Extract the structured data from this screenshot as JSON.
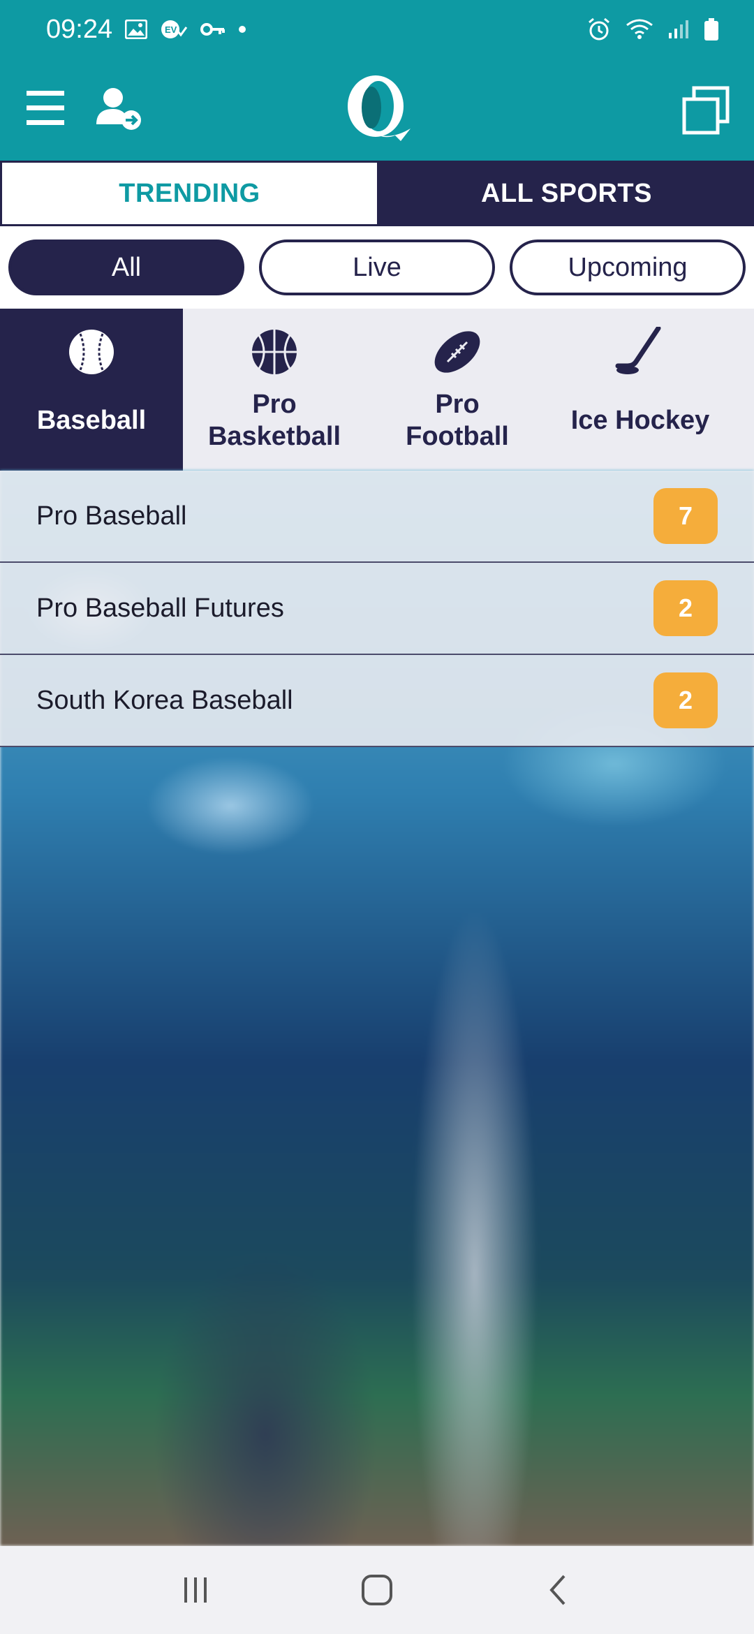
{
  "status_bar": {
    "time": "09:24",
    "left_icons": [
      "image-icon",
      "ev-check-icon",
      "key-icon",
      "dot-icon"
    ],
    "right_icons": [
      "alarm-icon",
      "wifi-icon",
      "signal-icon",
      "battery-icon"
    ]
  },
  "app_bar": {
    "menu_icon": "hamburger-menu-icon",
    "login_icon": "user-login-icon",
    "logo_icon": "q-logo",
    "switch_icon": "window-switch-icon"
  },
  "tabs": [
    {
      "label": "TRENDING",
      "active": true
    },
    {
      "label": "ALL SPORTS",
      "active": false
    }
  ],
  "filters": [
    {
      "label": "All",
      "selected": true
    },
    {
      "label": "Live",
      "selected": false
    },
    {
      "label": "Upcoming",
      "selected": false
    }
  ],
  "sports": [
    {
      "line1": "Baseball",
      "line2": "",
      "icon": "baseball-icon",
      "selected": true
    },
    {
      "line1": "Pro",
      "line2": "Basketball",
      "icon": "basketball-icon",
      "selected": false
    },
    {
      "line1": "Pro",
      "line2": "Football",
      "icon": "football-icon",
      "selected": false
    },
    {
      "line1": "Ice Hockey",
      "line2": "",
      "icon": "hockey-stick-icon",
      "selected": false
    }
  ],
  "leagues": [
    {
      "name": "Pro Baseball",
      "count": "7"
    },
    {
      "name": "Pro Baseball Futures",
      "count": "2"
    },
    {
      "name": "South Korea Baseball",
      "count": "2"
    }
  ],
  "nav_bar": {
    "recents_icon": "recent-apps-icon",
    "home_icon": "home-icon",
    "back_icon": "back-icon"
  },
  "colors": {
    "teal": "#0e9aa3",
    "navy": "#25234b",
    "badge": "#f5ad3b"
  }
}
